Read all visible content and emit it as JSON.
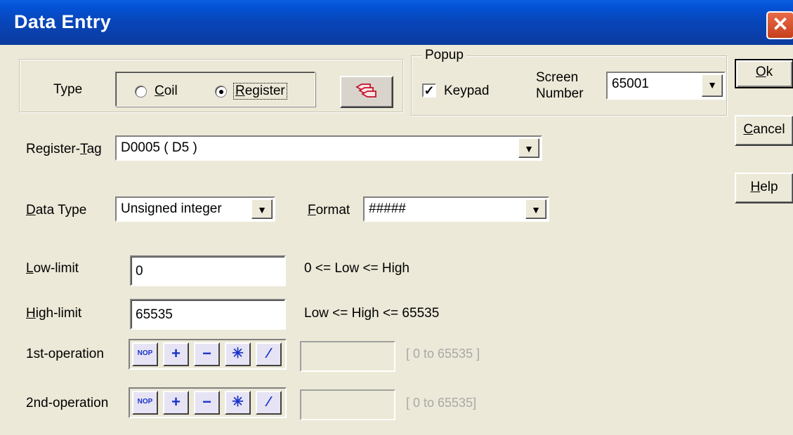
{
  "window": {
    "title": "Data Entry",
    "close_glyph": "✕"
  },
  "type_group": {
    "label": "Type",
    "options": [
      {
        "label": "Coil",
        "selected": false
      },
      {
        "label": "Register",
        "selected": true
      }
    ],
    "tag_button_icon": "tags-icon"
  },
  "popup_group": {
    "legend": "Popup",
    "keypad_label": "Keypad",
    "keypad_checked": true,
    "check_glyph": "✓",
    "screen_label_line1": "Screen",
    "screen_label_line2": "Number",
    "screen_number": "65001"
  },
  "buttons": {
    "ok": "Ok",
    "cancel": "Cancel",
    "help": "Help"
  },
  "register_tag": {
    "label": "Register-Tag",
    "value": "D0005 ( D5 )"
  },
  "data_type": {
    "label": "Data Type",
    "value": "Unsigned integer"
  },
  "format": {
    "label": "Format",
    "value": "#####"
  },
  "low_limit": {
    "label": "Low-limit",
    "value": "0",
    "hint": "0 <= Low <= High"
  },
  "high_limit": {
    "label": "High-limit",
    "value": "65535",
    "hint": "Low <= High <= 65535"
  },
  "operations": [
    {
      "label": "1st-operation",
      "range": "[ 0 to 65535 ]",
      "value": ""
    },
    {
      "label": "2nd-operation",
      "range": "[ 0 to 65535]",
      "value": ""
    }
  ],
  "op_buttons": [
    "NOP",
    "+",
    "−",
    "✳",
    "⁄"
  ],
  "dropdown_glyph": "▼"
}
